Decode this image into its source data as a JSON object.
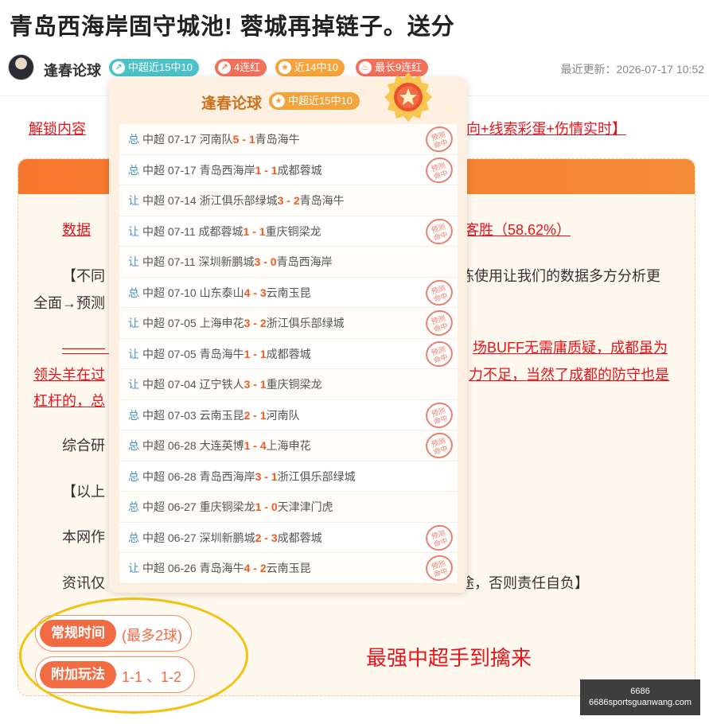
{
  "article": {
    "title": "青岛西海岸固守城池! 蓉城再掉链子。送分"
  },
  "author": {
    "name": "逢春论球",
    "badges": {
      "recent": "中超近15中10",
      "streak": "4连红",
      "recent14": "近14中10",
      "max_streak": "最长9连红"
    },
    "updated": "最近更新：2026-07-17 10:52"
  },
  "content": {
    "unlock_left": "解锁内容",
    "unlock_right": "向+线索彩蛋+伤情实时】",
    "data_left": "数据",
    "data_right": "客胜（58.62%）",
    "diff_left": "【不同",
    "diff_right": "练使用让我们的数据多方分析更",
    "diff_line2": "全面→预测",
    "analysis_left1": "———（",
    "analysis_right1": "场BUFF无需庸质疑，成都虽为",
    "analysis_left2": "领头羊在过",
    "analysis_right2": "力不足，当然了成都的防守也是",
    "analysis_left3": "杠杆的，总",
    "composite": "综合研",
    "above": "【以上",
    "site": "本网作",
    "info_left": "资讯仅",
    "info_right": "途，否则责任自负】"
  },
  "picks": {
    "regular_label": "常规时间",
    "regular_value": "(最多2球)",
    "extra_label": "附加玩法",
    "extra_value": "1-1 、1-2"
  },
  "slogan": "最强中超手到擒来",
  "watermark": {
    "line1": "6686",
    "line2": "6686sportsguanwang.com"
  },
  "popup": {
    "name": "逢春论球",
    "badge": "中超近15中10",
    "stamp_text": [
      "预测",
      "命中"
    ],
    "records": [
      {
        "kind": "总",
        "meta": "中超 07-17 河南队",
        "home_score": "5",
        "sep": " - ",
        "away_score": "1",
        "away": "青岛海牛",
        "hit": true
      },
      {
        "kind": "总",
        "meta": "中超 07-17 青岛西海岸",
        "home_score": "1",
        "sep": " - ",
        "away_score": "1",
        "away": "成都蓉城",
        "hit": true
      },
      {
        "kind": "让",
        "meta": "中超 07-14 浙江俱乐部绿城",
        "home_score": "3",
        "sep": " - ",
        "away_score": "2",
        "away": "青岛海牛",
        "hit": false
      },
      {
        "kind": "让",
        "meta": "中超 07-11 成都蓉城",
        "home_score": "1",
        "sep": " - ",
        "away_score": "1",
        "away": "重庆铜梁龙",
        "hit": true
      },
      {
        "kind": "让",
        "meta": "中超 07-11 深圳新鹏城",
        "home_score": "3",
        "sep": " - ",
        "away_score": "0",
        "away": "青岛西海岸",
        "hit": false
      },
      {
        "kind": "总",
        "meta": "中超 07-10 山东泰山",
        "home_score": "4",
        "sep": " - ",
        "away_score": "3",
        "away": "云南玉昆",
        "hit": true
      },
      {
        "kind": "让",
        "meta": "中超 07-05 上海申花",
        "home_score": "3",
        "sep": " - ",
        "away_score": "2",
        "away": "浙江俱乐部绿城",
        "hit": true
      },
      {
        "kind": "让",
        "meta": "中超 07-05 青岛海牛",
        "home_score": "1",
        "sep": " - ",
        "away_score": "1",
        "away": "成都蓉城",
        "hit": true
      },
      {
        "kind": "让",
        "meta": "中超 07-04 辽宁铁人",
        "home_score": "3",
        "sep": " - ",
        "away_score": "1",
        "away": "重庆铜梁龙",
        "hit": false
      },
      {
        "kind": "总",
        "meta": "中超 07-03 云南玉昆",
        "home_score": "2",
        "sep": " - ",
        "away_score": "1",
        "away": "河南队",
        "hit": true
      },
      {
        "kind": "总",
        "meta": "中超 06-28 大连英博",
        "home_score": "1",
        "sep": " - ",
        "away_score": "4",
        "away": "上海申花",
        "hit": true
      },
      {
        "kind": "总",
        "meta": "中超 06-28 青岛西海岸",
        "home_score": "3",
        "sep": " - ",
        "away_score": "1",
        "away": "浙江俱乐部绿城",
        "hit": false
      },
      {
        "kind": "总",
        "meta": "中超 06-27 重庆铜梁龙",
        "home_score": "1",
        "sep": " - ",
        "away_score": "0",
        "away": "天津津门虎",
        "hit": false
      },
      {
        "kind": "总",
        "meta": "中超 06-27 深圳新鹏城",
        "home_score": "2",
        "sep": " - ",
        "away_score": "3",
        "away": "成都蓉城",
        "hit": true
      },
      {
        "kind": "让",
        "meta": "中超 06-26 青岛海牛",
        "home_score": "4",
        "sep": " - ",
        "away_score": "2",
        "away": "云南玉昆",
        "hit": true
      }
    ]
  }
}
